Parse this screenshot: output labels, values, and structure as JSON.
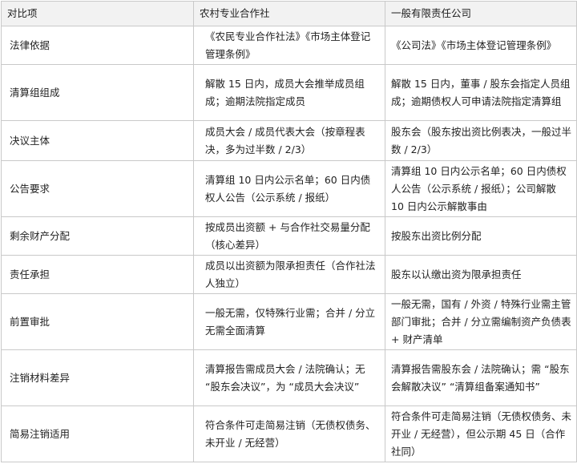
{
  "table": {
    "headers": [
      "对比项",
      "农村专业合作社",
      "一般有限责任公司"
    ],
    "rows": [
      {
        "item": "法律依据",
        "coop": "《农民专业合作社法》《市场主体登记管理条例》",
        "company": "《公司法》《市场主体登记管理条例》"
      },
      {
        "item": "清算组组成",
        "coop": "解散 15 日内，成员大会推举成员组成；逾期法院指定成员",
        "company": "解散 15 日内，董事 / 股东会指定人员组成；逾期债权人可申请法院指定清算组"
      },
      {
        "item": "决议主体",
        "coop": "成员大会 / 成员代表大会（按章程表决，多为过半数 / 2/3）",
        "company": "股东会（股东按出资比例表决，一般过半数 / 2/3）"
      },
      {
        "item": "公告要求",
        "coop": "清算组 10 日内公示名单；60 日内债权人公告（公示系统 / 报纸）",
        "company": "清算组 10 日内公示名单；60 日内债权人公告（公示系统 / 报纸）；公司解散 10 日内公示解散事由"
      },
      {
        "item": "剩余财产分配",
        "coop": "按成员出资额 + 与合作社交易量分配（核心差异）",
        "company": "按股东出资比例分配"
      },
      {
        "item": "责任承担",
        "coop": "成员以出资额为限承担责任（合作社法人独立）",
        "company": "股东以认缴出资为限承担责任"
      },
      {
        "item": "前置审批",
        "coop": "一般无需，仅特殊行业需；合并 / 分立无需全面清算",
        "company": "一般无需，国有 / 外资 / 特殊行业需主管部门审批；合并 / 分立需编制资产负债表 + 财产清单"
      },
      {
        "item": "注销材料差异",
        "coop": "清算报告需成员大会 / 法院确认；无 “股东会决议”，为 “成员大会决议”",
        "company": "清算报告需股东会 / 法院确认；需 “股东会解散决议” “清算组备案通知书”"
      },
      {
        "item": "简易注销适用",
        "coop": "符合条件可走简易注销（无债权债务、未开业 / 无经营）",
        "company": "符合条件可走简易注销（无债权债务、未开业 / 无经营），但公示期 45 日（合作社同）"
      }
    ]
  }
}
